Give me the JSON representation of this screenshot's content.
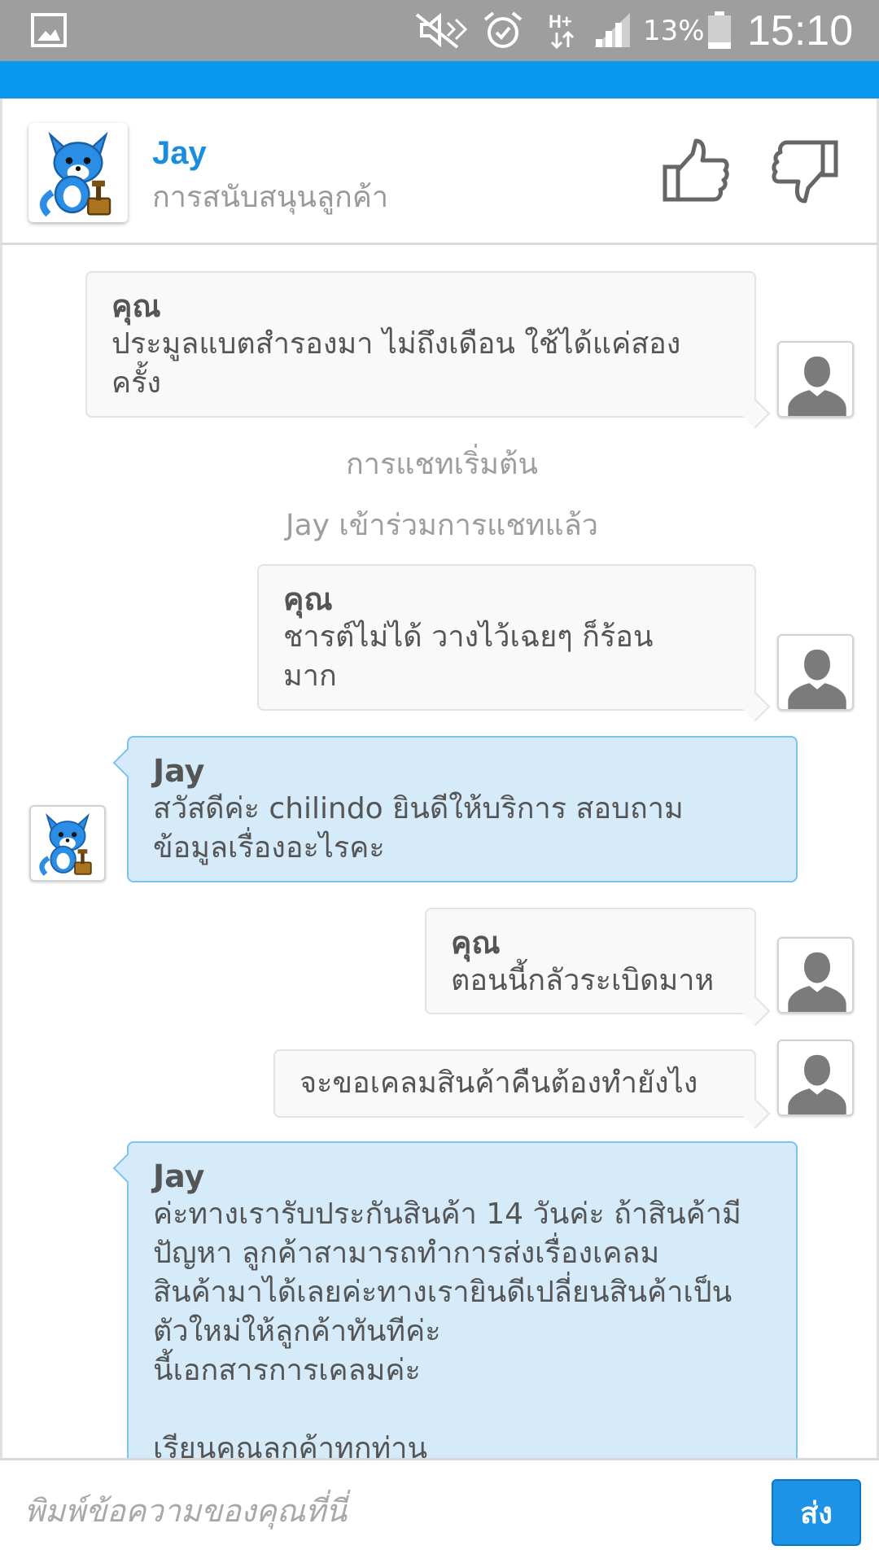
{
  "status_bar": {
    "battery_percent": "13%",
    "time": "15:10",
    "icons": [
      "gallery-icon",
      "mute-icon",
      "alarm-icon",
      "hplus-data-icon",
      "signal-icon",
      "battery-icon"
    ]
  },
  "header": {
    "agent_name": "Jay",
    "agent_role": "การสนับสนุนลูกค้า",
    "thumbs_up_icon": "thumbs-up-icon",
    "thumbs_down_icon": "thumbs-down-icon"
  },
  "chat": {
    "messages": [
      {
        "sender": "คุณ",
        "text": "ประมูลแบตสำรองมา ไม่ถึงเดือน ใช้ได้แค่สอง\nครั้ง"
      },
      {
        "system": "การแชทเริ่มต้น"
      },
      {
        "system": "Jay เข้าร่วมการแชทแล้ว"
      },
      {
        "sender": "คุณ",
        "text": "ชารต์ไม่ได้ วางไว้เฉยๆ ก็ร้อน\nมาก"
      },
      {
        "sender": "Jay",
        "text": "สวัสดีค่ะ chilindo ยินดีให้บริการ สอบถาม\nข้อมูลเรื่องอะไรคะ"
      },
      {
        "sender": "คุณ",
        "text": "ตอนนี้กลัวระเบิดมาห"
      },
      {
        "sender": "",
        "text": "จะขอเคลมสินค้าคืนต้องทำยังไง"
      },
      {
        "sender": "Jay",
        "text": "ค่ะทางเรารับประกันสินค้า 14 วันค่ะ ถ้าสินค้ามี\nปัญหา ลูกค้าสามารถทำการส่งเรื่องเคลม\nสินค้ามาได้เลยค่ะทางเรายินดีเปลี่ยนสินค้าเป็น\nตัวใหม่ให้ลูกค้าทันทีค่ะ\nนี้เอกสารการเคลมค่ะ\n\nเรียนคุณลูกค้าทุกท่าน"
      }
    ]
  },
  "input": {
    "placeholder": "พิมพ์ข้อความของคุณที่นี่",
    "value": "",
    "send_label": "ส่ง"
  },
  "colors": {
    "accent": "#0a99ef",
    "agent_name": "#1b8de0",
    "agent_bubble": "#d6ebfa",
    "user_bubble": "#f9f9f9",
    "send_button": "#1c93e6"
  }
}
